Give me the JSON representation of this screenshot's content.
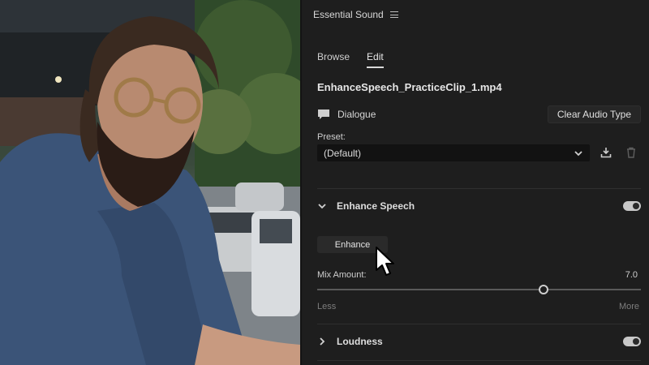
{
  "panel": {
    "title": "Essential Sound",
    "tabs": [
      {
        "label": "Browse",
        "active": false
      },
      {
        "label": "Edit",
        "active": true
      }
    ],
    "clip_name": "EnhanceSpeech_PracticeClip_1.mp4",
    "audio_type": {
      "label": "Dialogue",
      "icon": "speech-bubble-icon"
    },
    "clear_audio_type_label": "Clear Audio Type",
    "preset": {
      "label": "Preset:",
      "value": "(Default)"
    },
    "enhance_speech": {
      "title": "Enhance Speech",
      "enabled": true,
      "enhance_button": "Enhance",
      "mix_amount": {
        "label": "Mix Amount:",
        "value": "7.0",
        "level": 0.7,
        "min_label": "Less",
        "max_label": "More"
      }
    },
    "loudness": {
      "title": "Loudness",
      "enabled": true
    }
  },
  "colors": {
    "panel_bg": "#1e1e1e",
    "text": "#d6d6d6",
    "muted_text": "#7d7d7d",
    "toggle_on": "#c8c8c8"
  }
}
